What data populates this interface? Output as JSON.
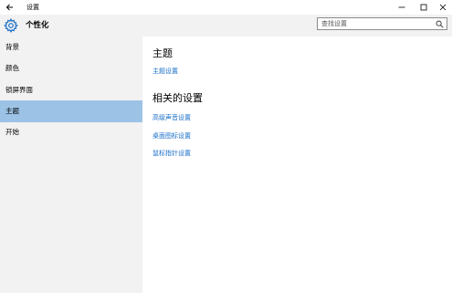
{
  "window": {
    "title": "设置"
  },
  "sidebar": {
    "title": "个性化",
    "items": [
      {
        "label": "背景"
      },
      {
        "label": "颜色"
      },
      {
        "label": "锁屏界面"
      },
      {
        "label": "主题"
      },
      {
        "label": "开始"
      }
    ],
    "active_index": 3
  },
  "search": {
    "placeholder": "查找设置"
  },
  "main": {
    "section1": {
      "title": "主题",
      "link": "主题设置"
    },
    "section2": {
      "title": "相关的设置",
      "links": [
        "高级声音设置",
        "桌面图标设置",
        "鼠标指针设置"
      ]
    }
  },
  "colors": {
    "accent_selected": "#9cc3e6",
    "link": "#1a6fc9",
    "sidebar_bg": "#f2f2f2"
  }
}
